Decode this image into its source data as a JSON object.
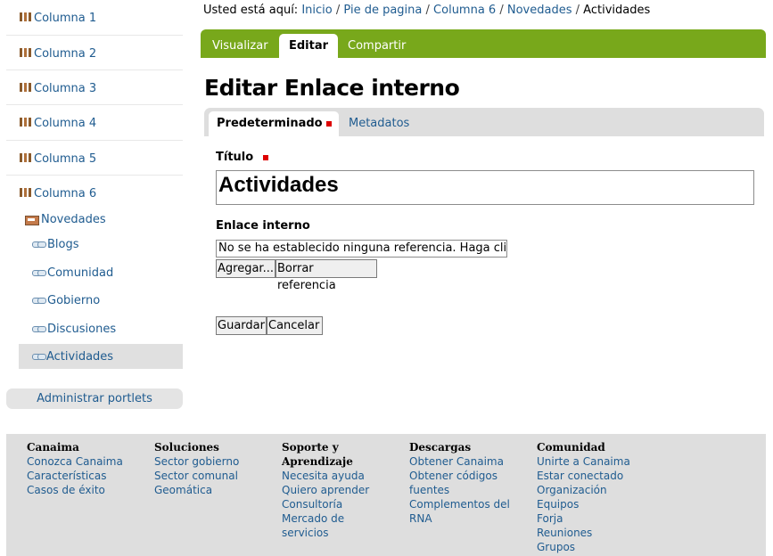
{
  "sidebar": {
    "items": [
      {
        "label": "Columna 1"
      },
      {
        "label": "Columna 2"
      },
      {
        "label": "Columna 3"
      },
      {
        "label": "Columna 4"
      },
      {
        "label": "Columna 5"
      },
      {
        "label": "Columna 6"
      }
    ],
    "collection": {
      "label": "Novedades"
    },
    "links": [
      {
        "label": "Blogs"
      },
      {
        "label": "Comunidad"
      },
      {
        "label": "Gobierno"
      },
      {
        "label": "Discusiones"
      },
      {
        "label": "Actividades"
      }
    ],
    "manage_portlets": "Administrar portlets"
  },
  "breadcrumb": {
    "prefix": "Usted está aquí:",
    "items": [
      "Inicio",
      "Pie de pagina",
      "Columna 6",
      "Novedades"
    ],
    "current": "Actividades",
    "separator": "/"
  },
  "view_tabs": [
    "Visualizar",
    "Editar",
    "Compartir"
  ],
  "page_title": "Editar Enlace interno",
  "field_tabs": [
    "Predeterminado",
    "Metadatos"
  ],
  "form": {
    "title_label": "Título",
    "title_value": "Actividades",
    "link_label": "Enlace interno",
    "link_value": "No se ha establecido ninguna referencia. Haga clic",
    "add_button": "Agregar...",
    "clear_button": "Borrar referencia",
    "save_button": "Guardar",
    "cancel_button": "Cancelar"
  },
  "footer": {
    "columns": [
      {
        "heading": "Canaima",
        "links": [
          "Conozca Canaima",
          "Características",
          "Casos de éxito"
        ]
      },
      {
        "heading": "Soluciones",
        "links": [
          "Sector gobierno",
          "Sector comunal",
          "Geomática"
        ]
      },
      {
        "heading": "Soporte y Aprendizaje",
        "links": [
          "Necesita ayuda",
          "Quiero aprender",
          "Consultoría",
          "Mercado de servicios"
        ]
      },
      {
        "heading": "Descargas",
        "links": [
          "Obtener Canaima",
          "Obtener códigos fuentes",
          "Complementos del RNA"
        ]
      },
      {
        "heading": "Comunidad",
        "links": [
          "Unirte a Canaima",
          "Estar conectado",
          "Organización",
          "Equipos",
          "Forja",
          "Reuniones",
          "Grupos"
        ]
      }
    ]
  },
  "colors": {
    "accent_green": "#78a81b",
    "link_blue": "#205c90",
    "required_red": "#dd0000",
    "footer_bg": "#dedede"
  },
  "icons": {
    "folder": "folder-icon",
    "collection": "collection-icon",
    "link": "link-icon",
    "required": "required-icon"
  }
}
